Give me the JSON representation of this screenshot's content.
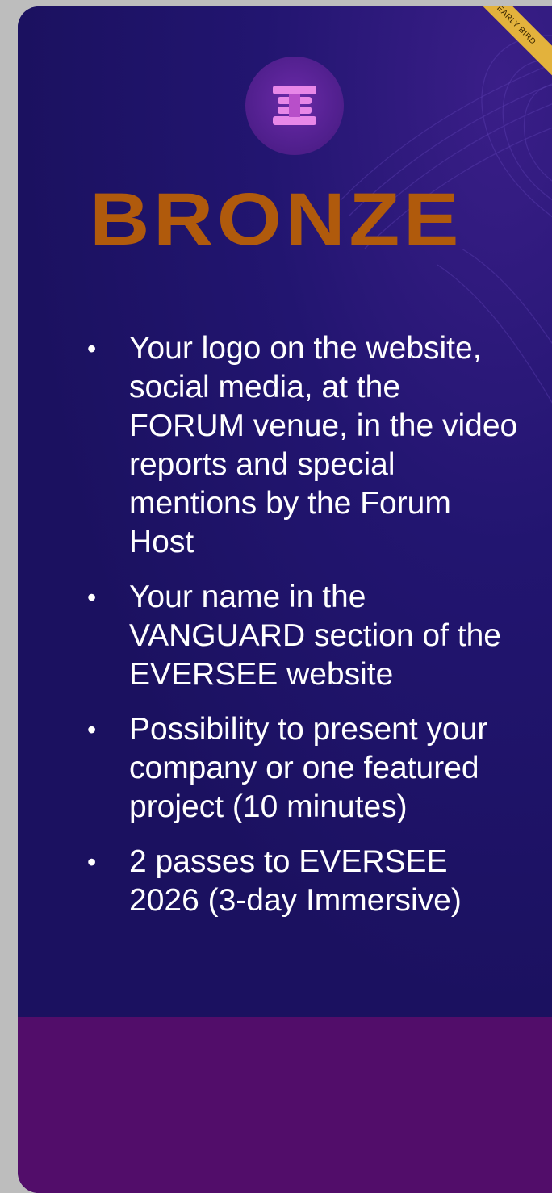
{
  "card": {
    "ribbon_text": "EARLY BIRD",
    "logo_icon": "eversee-logo-icon",
    "title": "BRONZE",
    "colors": {
      "title": "#b05a0c",
      "background": "#1b1160",
      "footer": "#520d6a",
      "ribbon": "#e3b23c"
    },
    "benefits": [
      {
        "text": "Your logo on the website, social media, at the FORUM venue, in the video reports and special mentions by the Forum Host"
      },
      {
        "text": "Your name in the VANGUARD section of the EVERSEE website"
      },
      {
        "text": "Possibility to present your company or one featured project (10 minutes)"
      },
      {
        "text": "2 passes to EVERSEE 2026 (3-day Immersive)"
      }
    ]
  }
}
